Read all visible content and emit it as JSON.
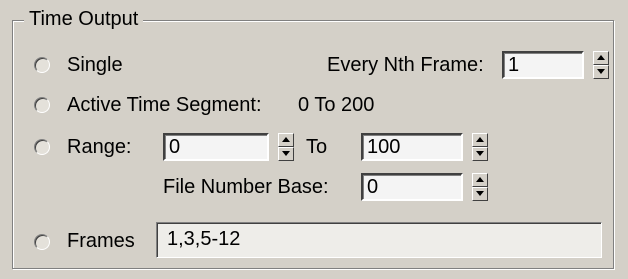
{
  "group": {
    "title": "Time Output"
  },
  "single": {
    "label": "Single"
  },
  "every_nth": {
    "label": "Every Nth Frame:",
    "value": "1"
  },
  "active_segment": {
    "label": "Active Time Segment:",
    "value": "0 To 200"
  },
  "range": {
    "label": "Range:",
    "from_value": "0",
    "to_label": "To",
    "to_value": "100"
  },
  "file_number_base": {
    "label": "File Number Base:",
    "value": "0"
  },
  "frames": {
    "label": "Frames",
    "value": "1,3,5-12"
  }
}
